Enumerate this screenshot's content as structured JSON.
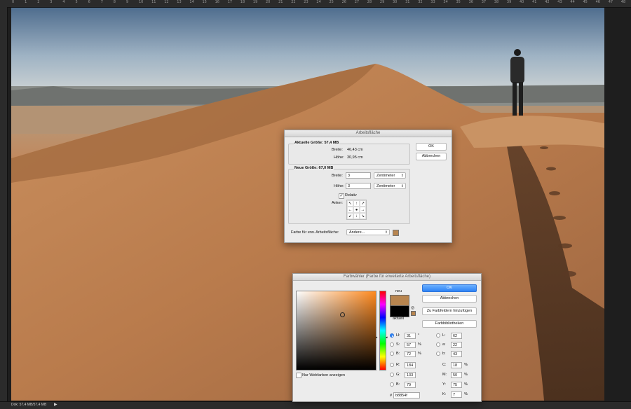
{
  "ruler": {
    "ticks": [
      "0",
      "1",
      "2",
      "3",
      "4",
      "5",
      "6",
      "7",
      "8",
      "9",
      "10",
      "11",
      "12",
      "13",
      "14",
      "15",
      "16",
      "17",
      "18",
      "19",
      "20",
      "21",
      "22",
      "23",
      "24",
      "25",
      "26",
      "27",
      "28",
      "29",
      "30",
      "31",
      "32",
      "33",
      "34",
      "35",
      "36",
      "37",
      "38",
      "39",
      "40",
      "41",
      "42",
      "43",
      "44",
      "45",
      "46",
      "47",
      "48"
    ]
  },
  "status": {
    "doc_info": "Dok: 57,4 MB/57,4 MB"
  },
  "canvas_dialog": {
    "title": "Arbeitsfläche",
    "current_size_label": "Aktuelle Größe: 57,4 MB",
    "width_label": "Breite:",
    "width_value": "46,43 cm",
    "height_label": "Höhe:",
    "height_value": "30,95 cm",
    "new_size_label": "Neue Größe: 67,0 MB",
    "new_width_label": "Breite:",
    "new_width_value": "3",
    "new_width_unit": "Zentimeter",
    "new_height_label": "Höhe:",
    "new_height_value": "3",
    "new_height_unit": "Zentimeter",
    "relative_label": "Relativ",
    "relative_checked": true,
    "anchor_label": "Anker:",
    "anchor_cells": [
      "↖",
      "↑",
      "↗",
      "←",
      "●",
      "→",
      "↙",
      "↓",
      "↘"
    ],
    "ext_color_label": "Farbe für erw. Arbeitsfläche:",
    "ext_color_value": "Andere...",
    "ext_color_swatch": "#b8854f",
    "ok_label": "OK",
    "cancel_label": "Abbrechen"
  },
  "color_picker": {
    "title": "Farbwähler (Farbe für erweiterte Arbeitsfläche)",
    "new_label": "neu",
    "current_label": "aktuell",
    "new_color": "#b8854f",
    "current_color": "#000000",
    "ok_label": "OK",
    "cancel_label": "Abbrechen",
    "add_swatch_label": "Zu Farbfeldern hinzufügen",
    "libraries_label": "Farbbibliotheken",
    "web_colors_label": "Nur Webfarben anzeigen",
    "hsb": [
      {
        "key": "H:",
        "value": "31",
        "unit": "°",
        "selected": true
      },
      {
        "key": "S:",
        "value": "57",
        "unit": "%",
        "selected": false
      },
      {
        "key": "B:",
        "value": "72",
        "unit": "%",
        "selected": false
      }
    ],
    "rgb": [
      {
        "key": "R:",
        "value": "184"
      },
      {
        "key": "G:",
        "value": "133"
      },
      {
        "key": "B:",
        "value": "79"
      }
    ],
    "lab": [
      {
        "key": "L:",
        "value": "62"
      },
      {
        "key": "a:",
        "value": "22"
      },
      {
        "key": "b:",
        "value": "43"
      }
    ],
    "cmyk": [
      {
        "key": "C:",
        "value": "18",
        "unit": "%"
      },
      {
        "key": "M:",
        "value": "50",
        "unit": "%"
      },
      {
        "key": "Y:",
        "value": "75",
        "unit": "%"
      },
      {
        "key": "K:",
        "value": "7",
        "unit": "%"
      }
    ],
    "hex_prefix": "#",
    "hex_value": "b8854f",
    "field_hue_color": "#ff8a1f"
  }
}
